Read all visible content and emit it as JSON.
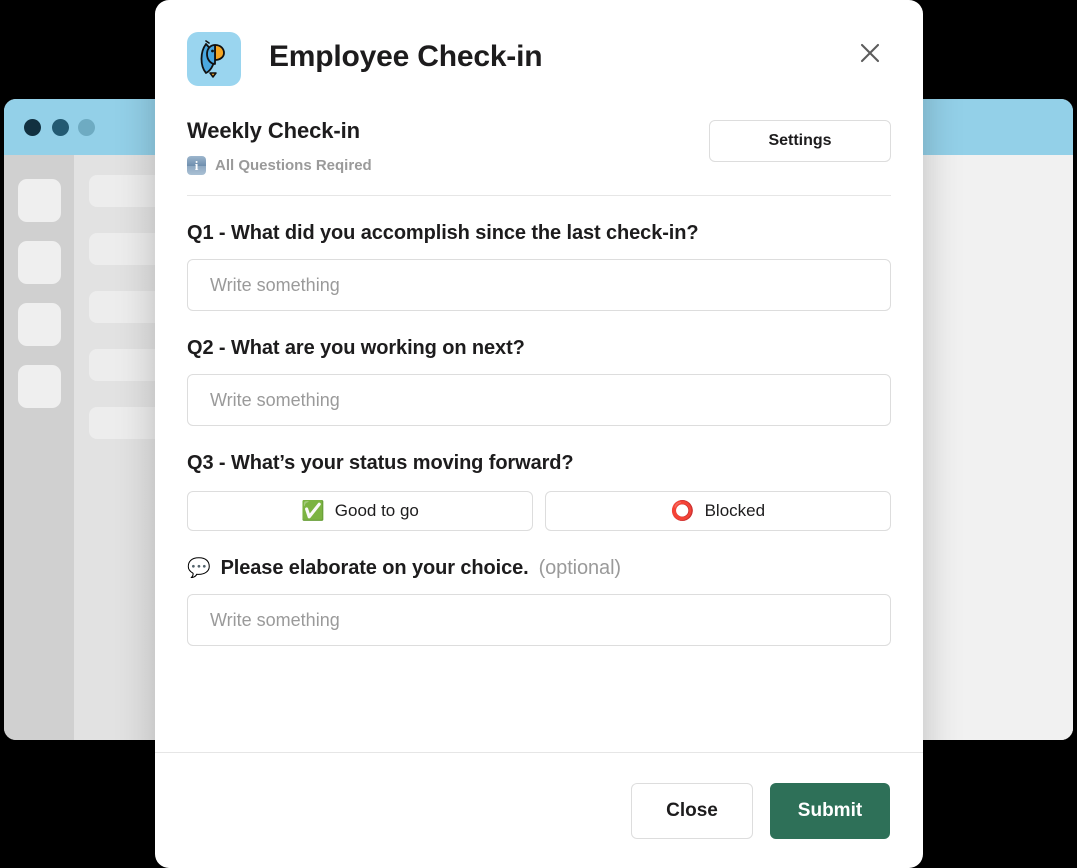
{
  "background_window": {
    "titlebar_color": "#93d0e8",
    "dots": [
      "#123040",
      "#235a72",
      "#6eabc2"
    ],
    "sidebar_color": "#d0d0d0",
    "content_color": "#e2e2e2",
    "sidebar_tiles": 3,
    "content_rows": 5
  },
  "modal": {
    "app_icon_name": "bird-app-icon",
    "app_icon_bg": "#9ad5ef",
    "title": "Employee Check-in",
    "close_icon": "close-icon",
    "subheader": {
      "title": "Weekly Check-in",
      "info_icon": "info-icon",
      "required_note": "All Questions Reqired",
      "settings_label": "Settings"
    },
    "questions": [
      {
        "label": "Q1 - What did you accomplish since the last check-in?",
        "input_value": "",
        "placeholder": "Write something"
      },
      {
        "label": "Q2 - What are you working on next?",
        "input_value": "",
        "placeholder": "Write something"
      },
      {
        "label": "Q3 - What’s your status moving forward?",
        "options": [
          {
            "emoji": "✅",
            "emoji_name": "white-check-mark-icon",
            "label": "Good to go"
          },
          {
            "emoji": "⭕",
            "emoji_name": "red-octagon-icon",
            "label": "Blocked"
          }
        ]
      }
    ],
    "elaborate": {
      "emoji": "💬",
      "emoji_name": "speech-balloon-icon",
      "label": "Please elaborate on your choice.",
      "optional_suffix": "(optional)",
      "input_value": "",
      "placeholder": "Write something"
    },
    "footer": {
      "close_label": "Close",
      "submit_label": "Submit",
      "submit_color": "#2e7058"
    }
  }
}
